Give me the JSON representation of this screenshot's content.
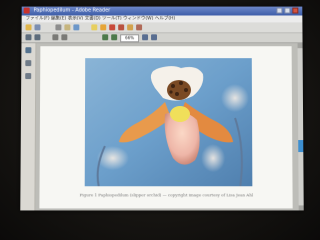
{
  "window": {
    "title": "Paphiopedilum - Adobe Reader",
    "menu": "ファイル(F)  編集(E)  表示(V)  文書(D)  ツール(T)  ウィンドウ(W)  ヘルプ(H)"
  },
  "toolbar": {
    "zoom_value": "66%"
  },
  "document": {
    "caption": "Figure 1    Paphiopedilum (slipper orchid) — copyright image courtesy of Lisa Jean Ahl"
  },
  "colors": {
    "titlebar": "#3c5ca8",
    "scroll_thumb": "#3d8fd0",
    "petal_orange": "#e89a4c",
    "pouch_pink": "#eeb6a8"
  }
}
